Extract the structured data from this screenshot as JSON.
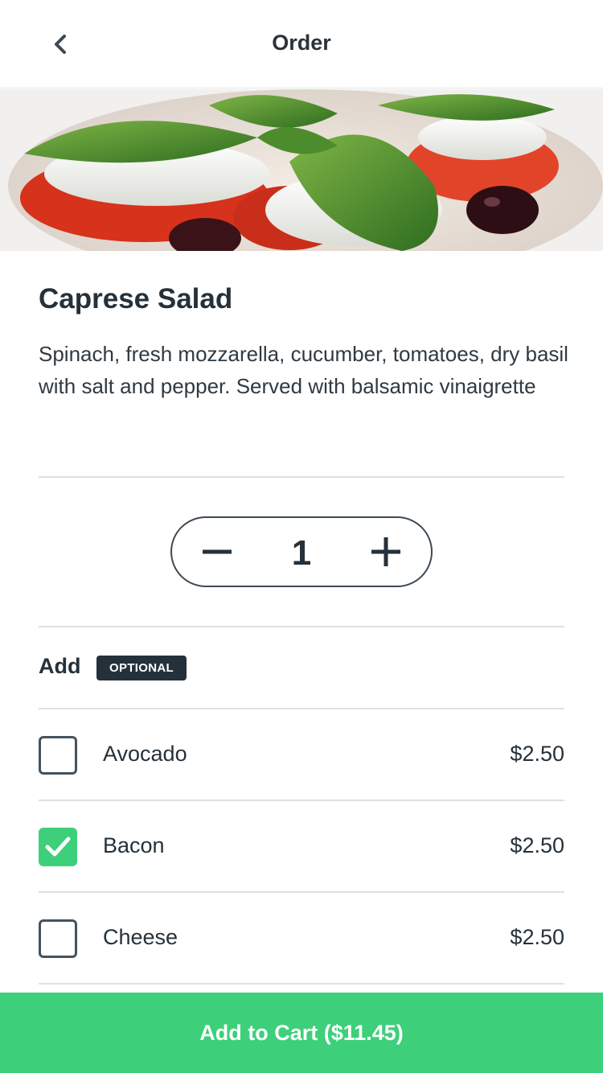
{
  "header": {
    "title": "Order",
    "back_icon": "chevron-left-icon"
  },
  "item": {
    "name": "Caprese Salad",
    "description": "Spinach, fresh mozzarella, cucumber, tomatoes, dry basil with salt and pepper. Served with balsamic vinaigrette"
  },
  "quantity": {
    "value": "1",
    "minus_icon": "minus-icon",
    "plus_icon": "plus-icon"
  },
  "add_section": {
    "label": "Add",
    "badge": "OPTIONAL",
    "options": [
      {
        "name": "Avocado",
        "price": "$2.50",
        "checked": false
      },
      {
        "name": "Bacon",
        "price": "$2.50",
        "checked": true
      },
      {
        "name": "Cheese",
        "price": "$2.50",
        "checked": false
      }
    ]
  },
  "cart": {
    "label": "Add to Cart ($11.45)"
  },
  "colors": {
    "accent": "#3ecf7b",
    "text": "#25313a",
    "badge_bg": "#25313a"
  }
}
